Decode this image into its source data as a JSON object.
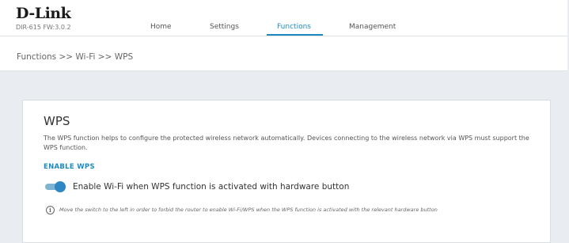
{
  "header": {
    "brand": "D-Link",
    "firmware": "DIR-615 FW:3.0.2",
    "nav": [
      {
        "label": "Home",
        "active": false
      },
      {
        "label": "Settings",
        "active": false
      },
      {
        "label": "Functions",
        "active": true
      },
      {
        "label": "Management",
        "active": false
      }
    ],
    "accent_color": "#1d8bc0"
  },
  "breadcrumb": "Functions >> Wi-Fi >> WPS",
  "card": {
    "title": "WPS",
    "description": "The WPS function helps to configure the protected wireless network automatically. Devices connecting to the wireless network via WPS must support the WPS function.",
    "section_heading": "ENABLE WPS",
    "toggle": {
      "label": "Enable Wi-Fi when WPS function is activated with hardware button",
      "state": "on"
    },
    "info_icon": "info-circle-icon",
    "note": "Move the switch to the left in order to forbid the router to enable Wi-Fi/WPS when the WPS function is activated with the relevant hardware button"
  }
}
